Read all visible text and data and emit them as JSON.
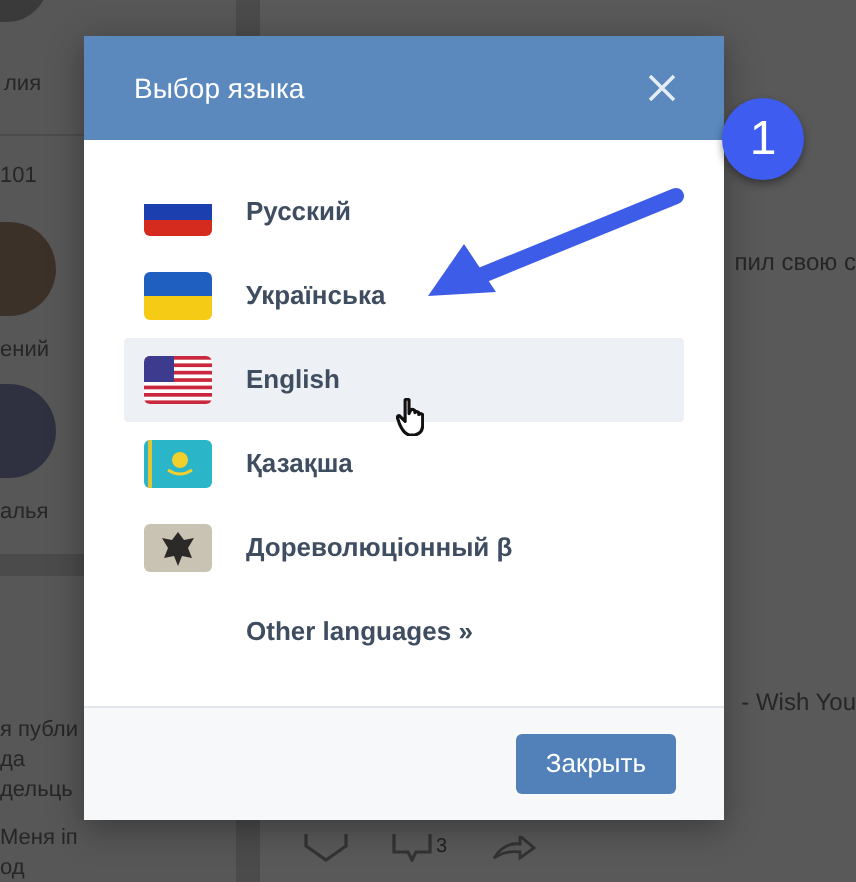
{
  "background": {
    "left_texts": [
      "лия",
      "101",
      "ений",
      "алья",
      "я публи",
      "да",
      "дельць",
      "Меня іп",
      "од"
    ],
    "right_texts": [
      "пил свою с",
      "- Wish You"
    ],
    "comment_count": "3"
  },
  "dialog": {
    "title": "Выбор языка",
    "languages": [
      {
        "label": "Русский",
        "kind": "ru",
        "highlighted": false
      },
      {
        "label": "Українська",
        "kind": "ua",
        "highlighted": false
      },
      {
        "label": "English",
        "kind": "us",
        "highlighted": true
      },
      {
        "label": "Қазақша",
        "kind": "kz",
        "highlighted": false
      },
      {
        "label": "Дореволюціонный β",
        "kind": "imperial",
        "highlighted": false
      }
    ],
    "other_languages": "Other languages »",
    "close_button": "Закрыть"
  },
  "annotation": {
    "step": "1"
  }
}
